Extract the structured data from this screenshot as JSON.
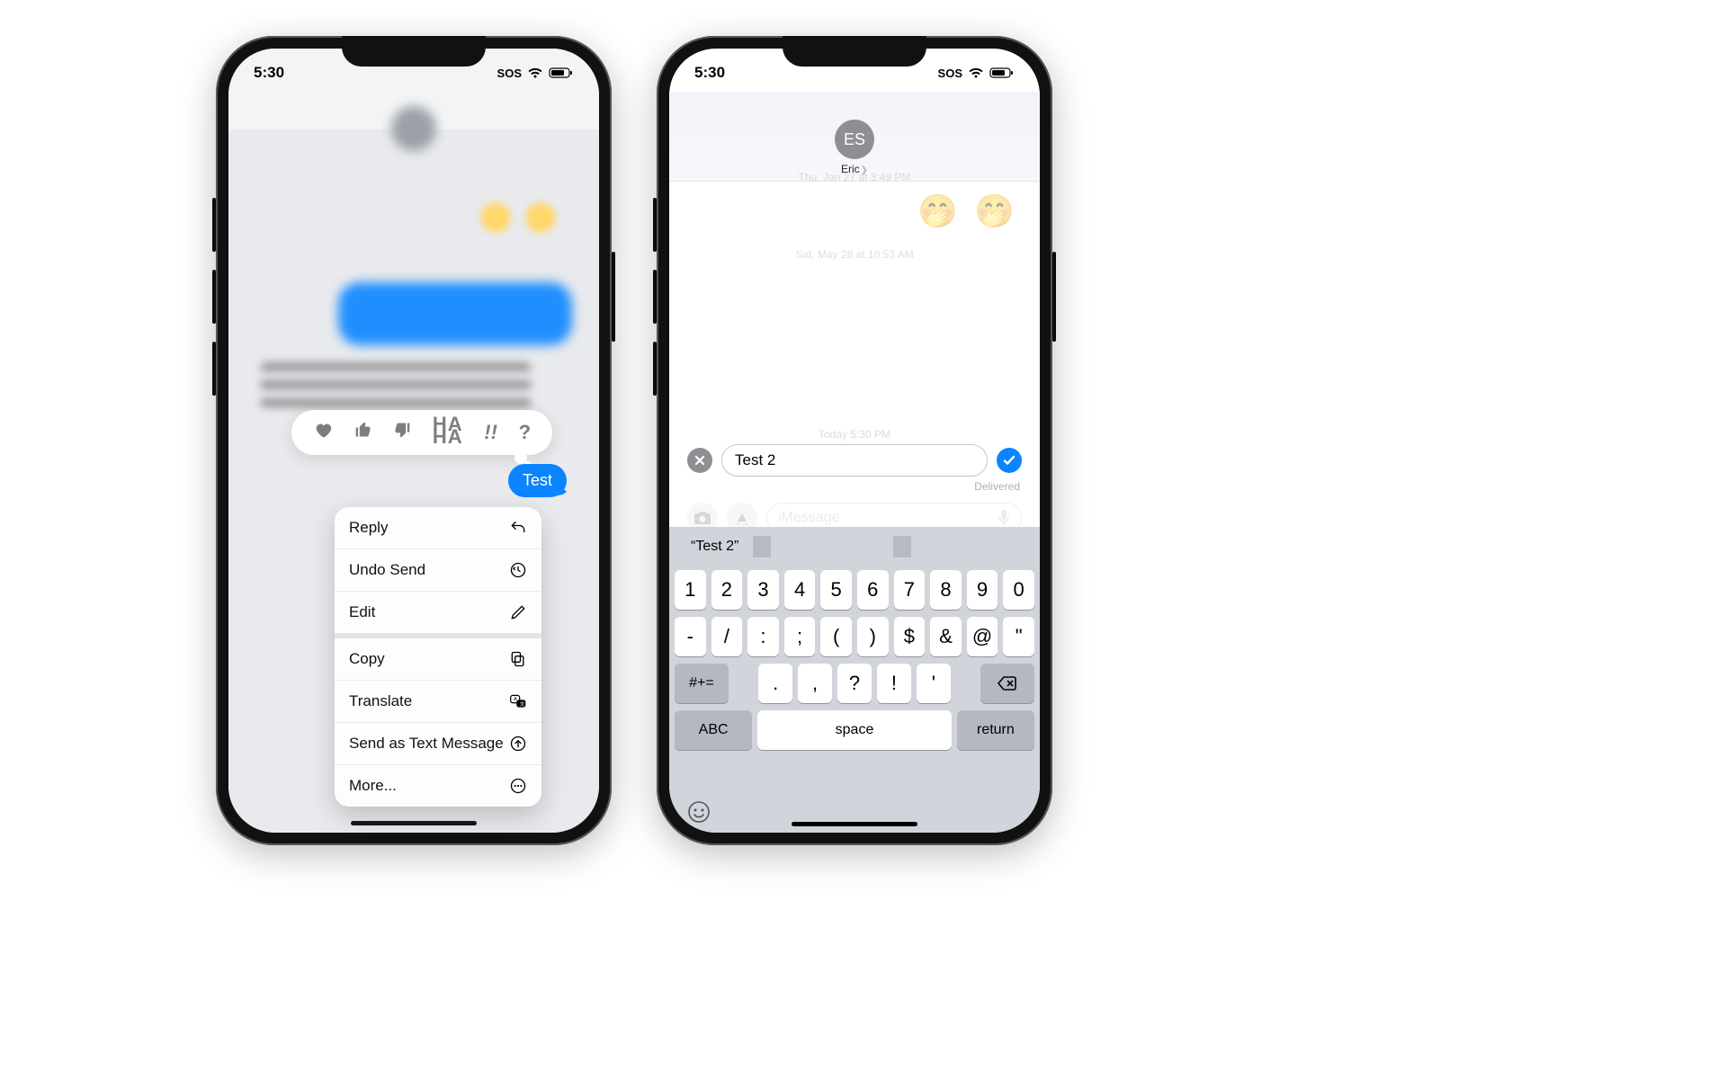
{
  "status": {
    "time": "5:30",
    "sos": "SOS"
  },
  "phone1": {
    "bubble_text": "Test",
    "tapback": {
      "haha_top": "HA",
      "haha_bot": "HA",
      "bang": "!!",
      "q": "?"
    },
    "menu": [
      {
        "label": "Reply"
      },
      {
        "label": "Undo Send"
      },
      {
        "label": "Edit"
      },
      {
        "label": "Copy"
      },
      {
        "label": "Translate"
      },
      {
        "label": "Send as Text Message"
      },
      {
        "label": "More..."
      }
    ]
  },
  "phone2": {
    "avatar": "ES",
    "name": "Eric",
    "ts1": "Thu, Jan 27 at 3:49 PM",
    "ts2": "Sat, May 28 at 10:53 AM",
    "ts3": "Today 5:30 PM",
    "emojis": "🤭 🤭",
    "edit_value": "Test 2",
    "delivered": "Delivered",
    "compose_placeholder": "iMessage",
    "suggest": "“Test 2”",
    "row1": [
      "1",
      "2",
      "3",
      "4",
      "5",
      "6",
      "7",
      "8",
      "9",
      "0"
    ],
    "row2": [
      "-",
      "/",
      ":",
      ";",
      "(",
      ")",
      "$",
      "&",
      "@",
      "\""
    ],
    "row3_shift": "#+=",
    "row3": [
      ".",
      ",",
      "?",
      "!",
      "'"
    ],
    "abc": "ABC",
    "space": "space",
    "return": "return"
  }
}
